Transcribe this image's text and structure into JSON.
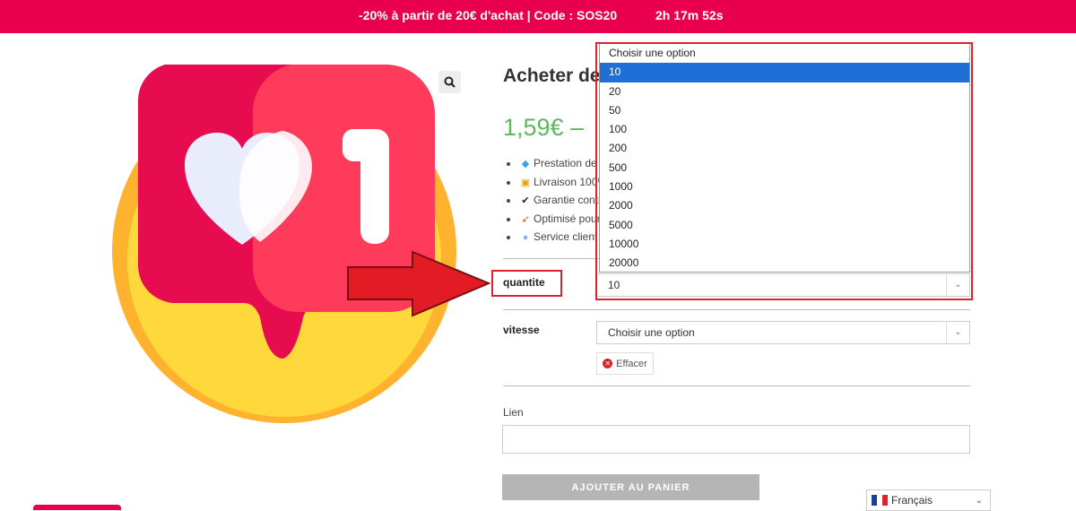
{
  "topbar": {
    "promo": "-20% à partir de 20€ d'achat | Code : SOS20",
    "timer": "2h 17m 52s"
  },
  "product": {
    "title": "Acheter des",
    "price": "1,59€ –",
    "features": [
      {
        "icon": "diamond-icon",
        "text": "Prestation de v"
      },
      {
        "icon": "lock-icon",
        "text": "Livraison 100%"
      },
      {
        "icon": "check-icon",
        "text": "Garantie contr"
      },
      {
        "icon": "rocket-icon",
        "text": "Optimisé pour"
      },
      {
        "icon": "speech-bubble-icon",
        "text": "Service client a"
      }
    ]
  },
  "form": {
    "quantite_label": "quantite",
    "quantite_value": "10",
    "dropdown_options": [
      "Choisir une option",
      "10",
      "20",
      "50",
      "100",
      "200",
      "500",
      "1000",
      "2000",
      "5000",
      "10000",
      "20000"
    ],
    "dropdown_selected": "10",
    "vitesse_label": "vitesse",
    "vitesse_value": "Choisir une option",
    "clear_label": "Effacer",
    "lien_label": "Lien",
    "lien_value": "",
    "add_to_cart_label": "AJOUTER AU PANIER"
  },
  "language": {
    "label": "Français"
  },
  "colors": {
    "brand": "#e8004f",
    "price": "#5cb85c",
    "highlight": "#d9232d",
    "selected_option": "#1e6fd6"
  }
}
